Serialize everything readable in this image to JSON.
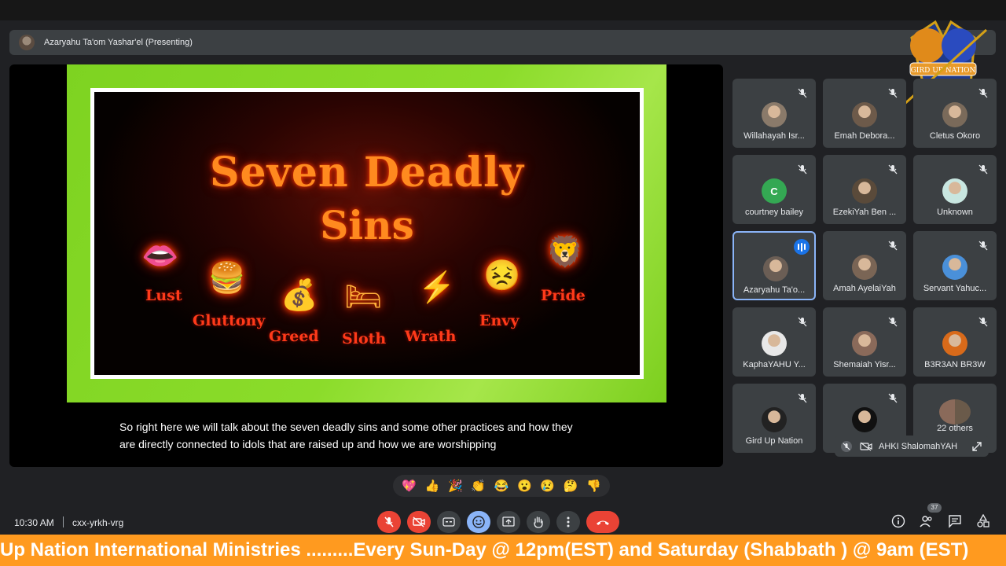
{
  "presenter": {
    "name": "Azaryahu Ta'om Yashar'el (Presenting)"
  },
  "logo": {
    "text": "GIRD UP NATION"
  },
  "slide": {
    "title_line1": "Seven Deadly",
    "title_line2": "Sins",
    "sins": [
      "Lust",
      "Gluttony",
      "Greed",
      "Sloth",
      "Wrath",
      "Envy",
      "Pride"
    ]
  },
  "caption": {
    "line1": "So right here we will talk about the seven deadly sins and some other practices and how they",
    "line2": "are directly connected to idols that are raised up and how we are worshipping"
  },
  "participants": [
    {
      "name": "Willahayah Isr...",
      "avatar": "photo",
      "color": "#8a7a6a"
    },
    {
      "name": "Emah Debora...",
      "avatar": "photo",
      "color": "#6d5a4a"
    },
    {
      "name": "Cletus Okoro",
      "avatar": "photo",
      "color": "#7a6a5a"
    },
    {
      "name": "courtney bailey",
      "avatar": "C",
      "color": "#34a853"
    },
    {
      "name": "EzekiYah Ben ...",
      "avatar": "photo",
      "color": "#5a4a3a"
    },
    {
      "name": "Unknown",
      "avatar": "photo",
      "color": "#c8e6e0"
    },
    {
      "name": "Azaryahu Ta'o...",
      "avatar": "photo",
      "color": "#6b5e55",
      "speaking": true
    },
    {
      "name": "Amah AyelaiYah",
      "avatar": "photo",
      "color": "#7a6555"
    },
    {
      "name": "Servant Yahuc...",
      "avatar": "photo",
      "color": "#4a90d9"
    },
    {
      "name": "KaphaYAHU Y...",
      "avatar": "photo",
      "color": "#e8e8e8"
    },
    {
      "name": "Shemaiah Yisr...",
      "avatar": "photo",
      "color": "#8a6a5a"
    },
    {
      "name": "B3R3AN BR3W",
      "avatar": "photo",
      "color": "#d86a1a"
    },
    {
      "name": "Gird Up Nation",
      "avatar": "photo",
      "color": "#222222"
    },
    {
      "name": "",
      "avatar": "photo",
      "color": "#111111"
    },
    {
      "name": "22 others",
      "avatar": "group",
      "color": "#5f6368"
    }
  ],
  "pinned": {
    "name": "AHKI ShalomahYAH"
  },
  "reactions": [
    "💖",
    "👍",
    "🎉",
    "👏",
    "😂",
    "😮",
    "😢",
    "🤔",
    "👎"
  ],
  "bottombar": {
    "time": "10:30 AM",
    "meeting_code": "cxx-yrkh-vrg",
    "participant_count": "37"
  },
  "ticker": {
    "text": "Up Nation International Ministries .........Every Sun-Day @ 12pm(EST) and Saturday (Shabbath ) @ 9am (EST)"
  },
  "colors": {
    "accent_blue": "#8ab4f8",
    "leave_red": "#ea4335",
    "ticker_orange": "#ff9a1f",
    "slide_green": "#7ed321"
  }
}
